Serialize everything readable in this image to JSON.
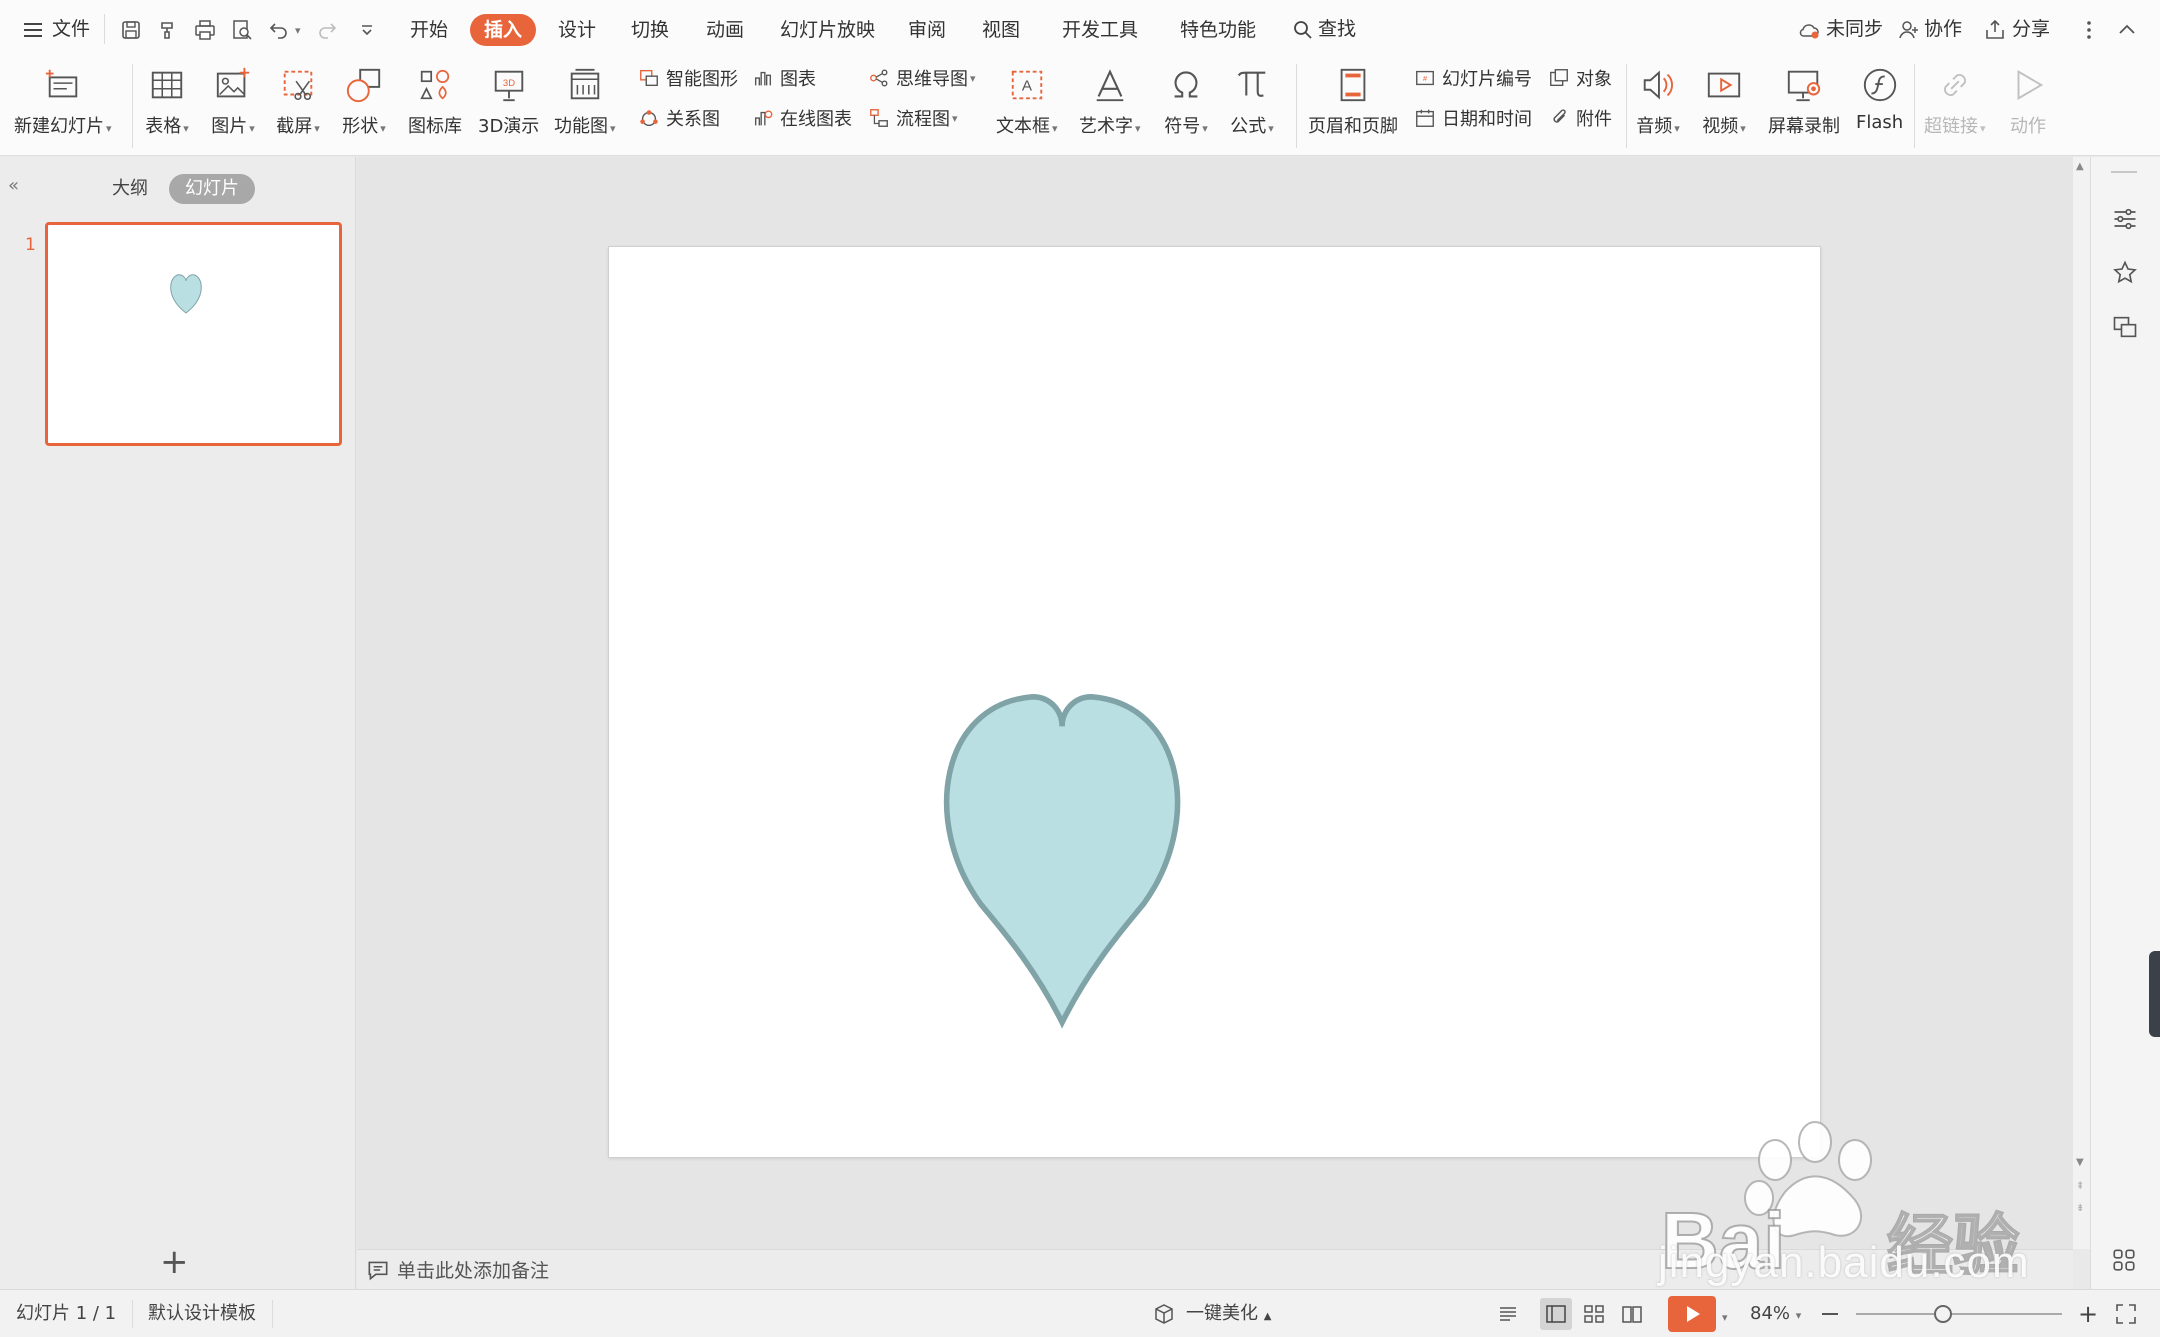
{
  "menubar": {
    "file_label": "文件",
    "tabs": [
      "开始",
      "插入",
      "设计",
      "切换",
      "动画",
      "幻灯片放映",
      "审阅",
      "视图",
      "开发工具",
      "特色功能"
    ],
    "active_tab": "插入",
    "search_label": "查找",
    "sync_label": "未同步",
    "collab_label": "协作",
    "share_label": "分享"
  },
  "ribbon": {
    "new_slide": "新建幻灯片",
    "table": "表格",
    "picture": "图片",
    "screenshot": "截屏",
    "shape": "形状",
    "icon_library": "图标库",
    "demo_3d": "3D演示",
    "function_chart": "功能图",
    "smart_art": "智能图形",
    "chart": "图表",
    "relation": "关系图",
    "online_chart": "在线图表",
    "mind_map": "思维导图",
    "flow_chart": "流程图",
    "text_box": "文本框",
    "word_art": "艺术字",
    "symbol": "符号",
    "formula": "公式",
    "header_footer": "页眉和页脚",
    "slide_number": "幻灯片编号",
    "object": "对象",
    "datetime": "日期和时间",
    "attachment": "附件",
    "audio": "音频",
    "video": "视频",
    "screen_record": "屏幕录制",
    "flash": "Flash",
    "hyperlink": "超链接",
    "action": "动作"
  },
  "panel": {
    "outline_tab": "大纲",
    "slides_tab": "幻灯片",
    "slide_number": "1"
  },
  "notes": {
    "placeholder": "单击此处添加备注"
  },
  "status": {
    "slide_info": "幻灯片 1 / 1",
    "template": "默认设计模板",
    "beautify": "一键美化",
    "zoom": "84%",
    "zoom_level": 0.42
  },
  "slide": {
    "heart_fill": "#b9dfe2",
    "heart_stroke": "#7fa3a7"
  },
  "watermark": {
    "logo_text": "Baidu经验",
    "url": "jingyan.baidu.com"
  },
  "colors": {
    "accent": "#e8643a"
  }
}
